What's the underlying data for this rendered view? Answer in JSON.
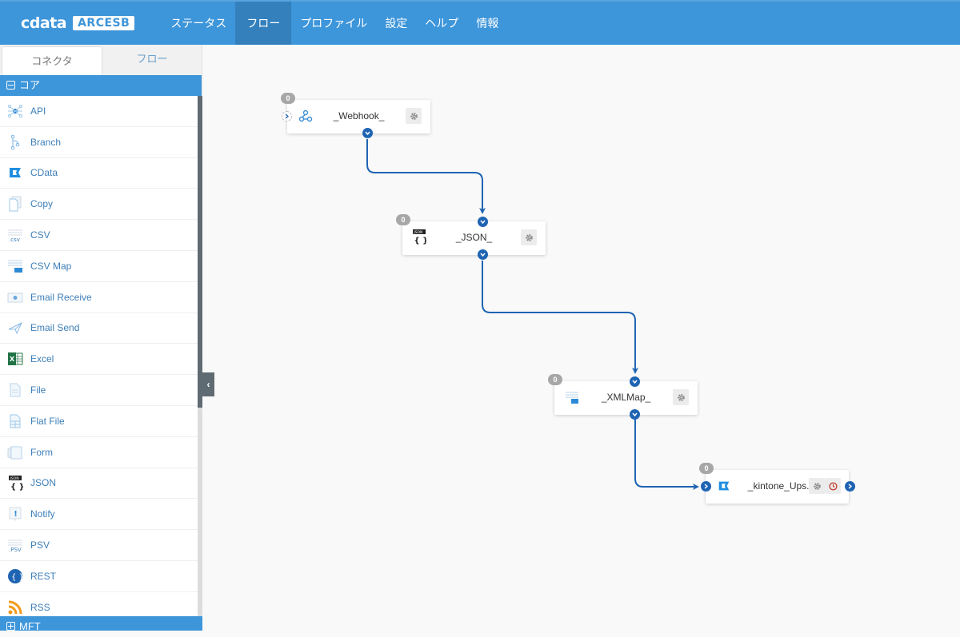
{
  "brand": {
    "logo_text": "cdata",
    "product": "ARCESB"
  },
  "nav": {
    "items": [
      {
        "label": "ステータス",
        "active": false
      },
      {
        "label": "フロー",
        "active": true
      },
      {
        "label": "プロファイル",
        "active": false
      },
      {
        "label": "設定",
        "active": false
      },
      {
        "label": "ヘルプ",
        "active": false
      },
      {
        "label": "情報",
        "active": false
      }
    ]
  },
  "sidebar": {
    "tabs": [
      {
        "label": "コネクタ",
        "active": true
      },
      {
        "label": "フロー",
        "active": false
      }
    ],
    "groups": [
      {
        "label": "コア",
        "expanded": true
      },
      {
        "label": "MFT",
        "expanded": false
      }
    ],
    "items": [
      {
        "label": "API",
        "icon": "api-icon"
      },
      {
        "label": "Branch",
        "icon": "branch-icon"
      },
      {
        "label": "CData",
        "icon": "cdata-icon"
      },
      {
        "label": "Copy",
        "icon": "copy-icon"
      },
      {
        "label": "CSV",
        "icon": "csv-icon"
      },
      {
        "label": "CSV Map",
        "icon": "csv-map-icon"
      },
      {
        "label": "Email Receive",
        "icon": "email-receive-icon"
      },
      {
        "label": "Email Send",
        "icon": "email-send-icon"
      },
      {
        "label": "Excel",
        "icon": "excel-icon"
      },
      {
        "label": "File",
        "icon": "file-icon"
      },
      {
        "label": "Flat File",
        "icon": "flat-file-icon"
      },
      {
        "label": "Form",
        "icon": "form-icon"
      },
      {
        "label": "JSON",
        "icon": "json-icon"
      },
      {
        "label": "Notify",
        "icon": "notify-icon"
      },
      {
        "label": "PSV",
        "icon": "psv-icon"
      },
      {
        "label": "REST",
        "icon": "rest-icon"
      },
      {
        "label": "RSS",
        "icon": "rss-icon"
      }
    ],
    "collapse_icon": "chevron-left-icon"
  },
  "flow": {
    "nodes": [
      {
        "id": "webhook",
        "title": "_Webhook_",
        "badge": "0",
        "icon": "webhook-icon"
      },
      {
        "id": "json",
        "title": "_JSON_",
        "badge": "0",
        "icon": "json-icon"
      },
      {
        "id": "xmlmap",
        "title": "_XMLMap_",
        "badge": "0",
        "icon": "xml-map-icon"
      },
      {
        "id": "kintone",
        "title": "_kintone_Ups...",
        "badge": "0",
        "icon": "cdata-icon"
      }
    ],
    "links": [
      {
        "from": "webhook",
        "to": "json"
      },
      {
        "from": "json",
        "to": "xmlmap"
      },
      {
        "from": "xmlmap",
        "to": "kintone"
      }
    ]
  },
  "colors": {
    "primary": "#3d95da",
    "nav_active": "#3380bd",
    "port": "#1f64b3",
    "link_text": "#3d7fb8",
    "scroll_thumb": "#5f6b73"
  }
}
